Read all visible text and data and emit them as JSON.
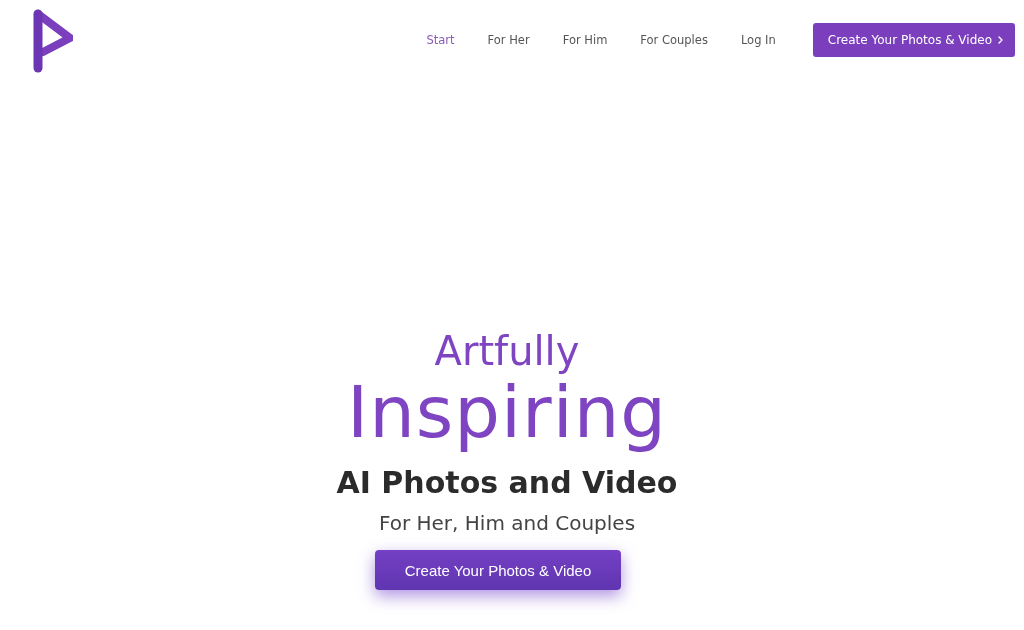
{
  "nav": {
    "items": [
      {
        "label": "Start",
        "selected": true
      },
      {
        "label": "For Her",
        "selected": false
      },
      {
        "label": "For Him",
        "selected": false
      },
      {
        "label": "For Couples",
        "selected": false
      },
      {
        "label": "Log In",
        "selected": false
      }
    ],
    "cta": {
      "label": "Create Your Photos & Video"
    }
  },
  "hero": {
    "kicker": "Artfully",
    "headline": "Inspiring",
    "subtitle": "AI Photos and Video",
    "tagline": "For Her, Him and Couples",
    "button": {
      "label": "Create Your Photos & Video"
    }
  }
}
